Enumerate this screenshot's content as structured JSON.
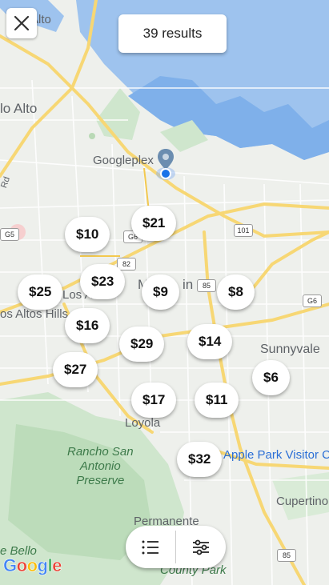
{
  "results_label": "39 results",
  "places": {
    "palo_alto": "lo Alto",
    "alto_top": "Alto",
    "googleplex": "Googleplex",
    "los_altos": "Los Al",
    "los_altos_hills": "os Altos Hills",
    "mountain_view": "M",
    "mountain_view2": "in",
    "sunnyvale": "Sunnyvale",
    "loyola": "Loyola",
    "rancho": "Rancho San\nAntonio\nPreserve",
    "apple_park": "Apple Park Visitor C",
    "cupertino": "Cupertino",
    "permanente": "Permanente",
    "bello": "e Bello",
    "county_park": "County Park",
    "rd": "Rd"
  },
  "shields": {
    "us101": "101",
    "r82": "82",
    "r85a": "85",
    "r85b": "85",
    "g6a": "G6",
    "g6b": "G6",
    "g5": "G5"
  },
  "price_pins": [
    "$10",
    "$21",
    "$23",
    "$25",
    "$9",
    "$8",
    "$16",
    "$29",
    "$14",
    "$27",
    "$6",
    "$17",
    "$11",
    "$32"
  ],
  "toolbar": {
    "list_icon": "list-icon",
    "filter_icon": "filter-sliders-icon"
  },
  "logo": "Google",
  "colors": {
    "water": "#9ec3ee",
    "road": "#f7d774",
    "park": "#cfe6cd",
    "pin_blue": "#1a73e8"
  }
}
